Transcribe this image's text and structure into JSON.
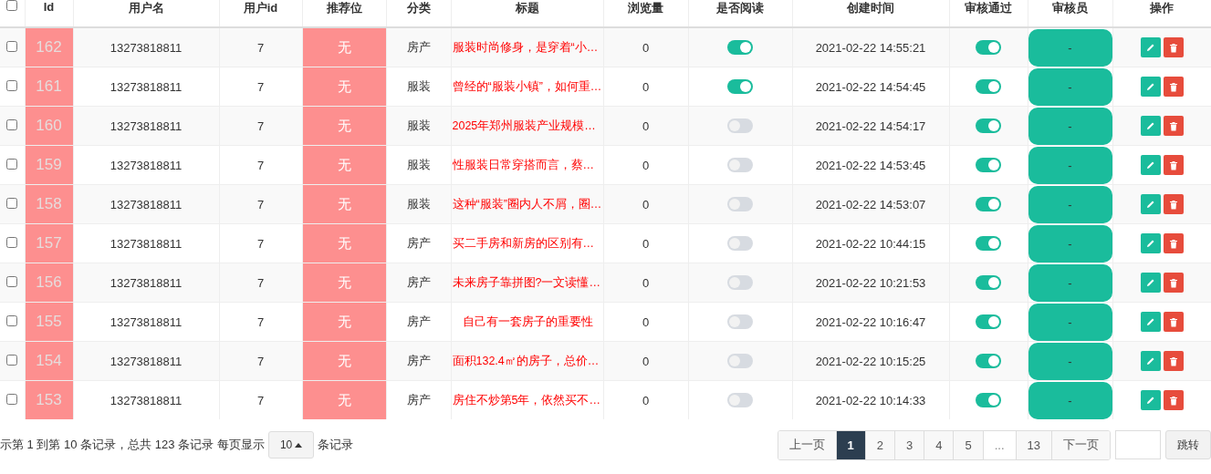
{
  "table": {
    "select_all_checked": false,
    "columns": [
      "Id",
      "用户名",
      "用户id",
      "推荐位",
      "分类",
      "标题",
      "浏览量",
      "是否阅读",
      "创建时间",
      "审核通过",
      "审核员",
      "操作"
    ],
    "rows": [
      {
        "checked": false,
        "id": "162",
        "username": "13273818811",
        "user_id": "7",
        "recommend": "无",
        "category": "房产",
        "title": "服装时尚修身，是穿着“小…",
        "views": "0",
        "read": true,
        "created": "2021-02-22 14:55:21",
        "approved": true,
        "reviewer": "-"
      },
      {
        "checked": false,
        "id": "161",
        "username": "13273818811",
        "user_id": "7",
        "recommend": "无",
        "category": "服装",
        "title": "曾经的“服装小镇”，如何重…",
        "views": "0",
        "read": true,
        "created": "2021-02-22 14:54:45",
        "approved": true,
        "reviewer": "-"
      },
      {
        "checked": false,
        "id": "160",
        "username": "13273818811",
        "user_id": "7",
        "recommend": "无",
        "category": "服装",
        "title": "2025年郑州服装产业规模…",
        "views": "0",
        "read": false,
        "created": "2021-02-22 14:54:17",
        "approved": true,
        "reviewer": "-"
      },
      {
        "checked": false,
        "id": "159",
        "username": "13273818811",
        "user_id": "7",
        "recommend": "无",
        "category": "服装",
        "title": "性服装日常穿搭而言，蔡…",
        "views": "0",
        "read": false,
        "created": "2021-02-22 14:53:45",
        "approved": true,
        "reviewer": "-"
      },
      {
        "checked": false,
        "id": "158",
        "username": "13273818811",
        "user_id": "7",
        "recommend": "无",
        "category": "服装",
        "title": "这种“服装”圈内人不屑，圈…",
        "views": "0",
        "read": false,
        "created": "2021-02-22 14:53:07",
        "approved": true,
        "reviewer": "-"
      },
      {
        "checked": false,
        "id": "157",
        "username": "13273818811",
        "user_id": "7",
        "recommend": "无",
        "category": "房产",
        "title": "买二手房和新房的区别有…",
        "views": "0",
        "read": false,
        "created": "2021-02-22 10:44:15",
        "approved": true,
        "reviewer": "-"
      },
      {
        "checked": false,
        "id": "156",
        "username": "13273818811",
        "user_id": "7",
        "recommend": "无",
        "category": "房产",
        "title": "未来房子靠拼图?一文读懂…",
        "views": "0",
        "read": false,
        "created": "2021-02-22 10:21:53",
        "approved": true,
        "reviewer": "-"
      },
      {
        "checked": false,
        "id": "155",
        "username": "13273818811",
        "user_id": "7",
        "recommend": "无",
        "category": "房产",
        "title": "自己有一套房子的重要性",
        "views": "0",
        "read": false,
        "created": "2021-02-22 10:16:47",
        "approved": true,
        "reviewer": "-"
      },
      {
        "checked": false,
        "id": "154",
        "username": "13273818811",
        "user_id": "7",
        "recommend": "无",
        "category": "房产",
        "title": "面积132.4㎡的房子，总价…",
        "views": "0",
        "read": false,
        "created": "2021-02-22 10:15:25",
        "approved": true,
        "reviewer": "-"
      },
      {
        "checked": false,
        "id": "153",
        "username": "13273818811",
        "user_id": "7",
        "recommend": "无",
        "category": "房产",
        "title": "房住不炒第5年，依然买不…",
        "views": "0",
        "read": false,
        "created": "2021-02-22 10:14:33",
        "approved": true,
        "reviewer": "-"
      }
    ]
  },
  "footer": {
    "summary": "示第 1 到第 10 条记录，总共 123 条记录",
    "per_page_label": "每页显示",
    "page_size": "10",
    "per_page_suffix": "条记录"
  },
  "pagination": {
    "prev": "上一页",
    "pages": [
      {
        "label": "1",
        "selected": true
      },
      {
        "label": "2",
        "selected": false
      },
      {
        "label": "3",
        "selected": false
      },
      {
        "label": "4",
        "selected": false
      },
      {
        "label": "5",
        "selected": false
      },
      {
        "label": "...",
        "selected": false
      },
      {
        "label": "13",
        "selected": false
      }
    ],
    "next": "下一页",
    "jump": "跳转"
  }
}
